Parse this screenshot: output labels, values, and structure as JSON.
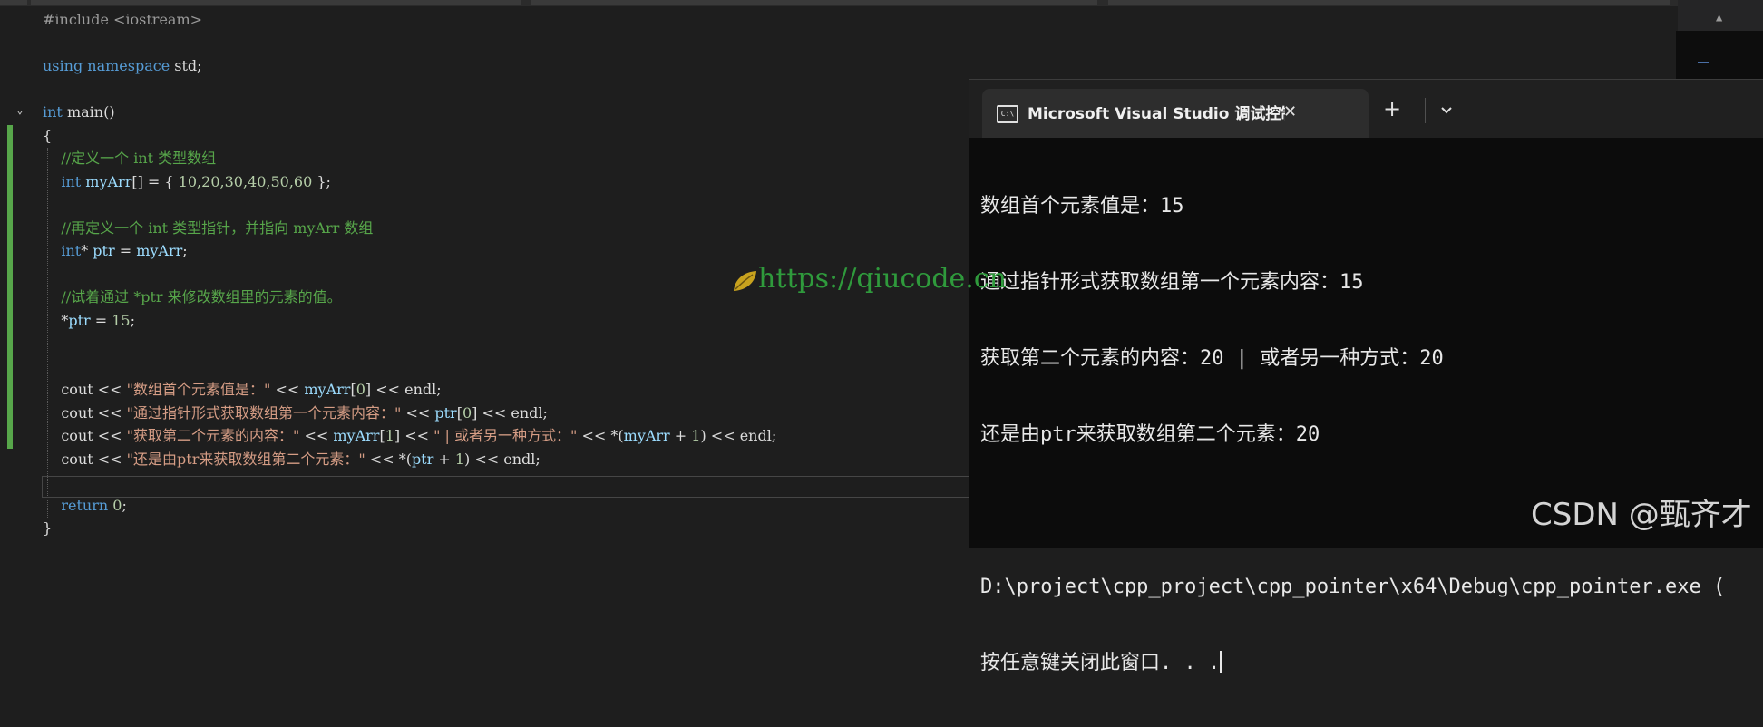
{
  "editor": {
    "lines": [
      {
        "tokens": [
          {
            "c": "pp",
            "t": "#include <iostream>"
          }
        ]
      },
      {
        "tokens": []
      },
      {
        "tokens": [
          {
            "c": "k",
            "t": "using namespace"
          },
          {
            "c": "p",
            "t": " std;"
          }
        ]
      },
      {
        "tokens": []
      },
      {
        "tokens": [
          {
            "c": "k",
            "t": "int"
          },
          {
            "c": "p",
            "t": " main()"
          }
        ]
      },
      {
        "tokens": [
          {
            "c": "p",
            "t": "{"
          }
        ]
      },
      {
        "tokens": [
          {
            "c": "cm",
            "t": "    //定义一个 int 类型数组"
          }
        ]
      },
      {
        "tokens": [
          {
            "c": "k",
            "t": "    int"
          },
          {
            "c": "v",
            "t": " myArr"
          },
          {
            "c": "p",
            "t": "[] = { "
          },
          {
            "c": "n",
            "t": "10,20,30,40,50,60"
          },
          {
            "c": "p",
            "t": " };"
          }
        ]
      },
      {
        "tokens": []
      },
      {
        "tokens": [
          {
            "c": "cm",
            "t": "    //再定义一个 int 类型指针，并指向 myArr 数组"
          }
        ]
      },
      {
        "tokens": [
          {
            "c": "k",
            "t": "    int"
          },
          {
            "c": "p",
            "t": "* "
          },
          {
            "c": "v",
            "t": "ptr"
          },
          {
            "c": "p",
            "t": " = "
          },
          {
            "c": "v",
            "t": "myArr"
          },
          {
            "c": "p",
            "t": ";"
          }
        ]
      },
      {
        "tokens": []
      },
      {
        "tokens": [
          {
            "c": "cm",
            "t": "    //试着通过 *ptr 来修改数组里的元素的值。"
          }
        ]
      },
      {
        "tokens": [
          {
            "c": "p",
            "t": "    *"
          },
          {
            "c": "v",
            "t": "ptr"
          },
          {
            "c": "p",
            "t": " = "
          },
          {
            "c": "n",
            "t": "15"
          },
          {
            "c": "p",
            "t": ";"
          }
        ]
      },
      {
        "tokens": []
      },
      {
        "tokens": []
      },
      {
        "tokens": [
          {
            "c": "p",
            "t": "    cout << "
          },
          {
            "c": "s",
            "t": "\"数组首个元素值是：\""
          },
          {
            "c": "p",
            "t": " << "
          },
          {
            "c": "v",
            "t": "myArr"
          },
          {
            "c": "p",
            "t": "["
          },
          {
            "c": "n",
            "t": "0"
          },
          {
            "c": "p",
            "t": "] << endl;"
          }
        ]
      },
      {
        "tokens": [
          {
            "c": "p",
            "t": "    cout << "
          },
          {
            "c": "s",
            "t": "\"通过指针形式获取数组第一个元素内容：\""
          },
          {
            "c": "p",
            "t": " << "
          },
          {
            "c": "v",
            "t": "ptr"
          },
          {
            "c": "p",
            "t": "["
          },
          {
            "c": "n",
            "t": "0"
          },
          {
            "c": "p",
            "t": "] << endl;"
          }
        ]
      },
      {
        "tokens": [
          {
            "c": "p",
            "t": "    cout << "
          },
          {
            "c": "s",
            "t": "\"获取第二个元素的内容：\""
          },
          {
            "c": "p",
            "t": " << "
          },
          {
            "c": "v",
            "t": "myArr"
          },
          {
            "c": "p",
            "t": "["
          },
          {
            "c": "n",
            "t": "1"
          },
          {
            "c": "p",
            "t": "] << "
          },
          {
            "c": "s",
            "t": "\" | 或者另一种方式：\""
          },
          {
            "c": "p",
            "t": " << *("
          },
          {
            "c": "v",
            "t": "myArr"
          },
          {
            "c": "p",
            "t": " + "
          },
          {
            "c": "n",
            "t": "1"
          },
          {
            "c": "p",
            "t": ") << endl;"
          }
        ]
      },
      {
        "tokens": [
          {
            "c": "p",
            "t": "    cout << "
          },
          {
            "c": "s",
            "t": "\"还是由ptr来获取数组第二个元素：\""
          },
          {
            "c": "p",
            "t": " << *("
          },
          {
            "c": "v",
            "t": "ptr"
          },
          {
            "c": "p",
            "t": " + "
          },
          {
            "c": "n",
            "t": "1"
          },
          {
            "c": "p",
            "t": ") << endl;"
          }
        ]
      },
      {
        "tokens": []
      },
      {
        "tokens": [
          {
            "c": "k",
            "t": "    return"
          },
          {
            "c": "p",
            "t": " "
          },
          {
            "c": "n",
            "t": "0"
          },
          {
            "c": "p",
            "t": ";"
          }
        ]
      },
      {
        "tokens": [
          {
            "c": "p",
            "t": "}"
          }
        ]
      }
    ]
  },
  "terminal": {
    "title": "Microsoft Visual Studio 调试控制台",
    "close_glyph": "✕",
    "new_tab_glyph": "+",
    "output": [
      "数组首个元素值是：15",
      "通过指针形式获取数组第一个元素内容：15",
      "获取第二个元素的内容：20 | 或者另一种方式：20",
      "还是由ptr来获取数组第二个元素：20",
      "",
      "D:\\project\\cpp_project\\cpp_pointer\\x64\\Debug\\cpp_pointer.exe (",
      "按任意键关闭此窗口. . ."
    ]
  },
  "overlay": {
    "watermark": "https://qiucode.cn",
    "credit": "CSDN @甄齐才"
  },
  "colors": {
    "editor_bg": "#1e1e1e",
    "keyword": "#569cd6",
    "comment": "#57a64a",
    "string": "#d69d85",
    "number": "#b5cea8",
    "terminal_bg": "#0c0c0c"
  }
}
